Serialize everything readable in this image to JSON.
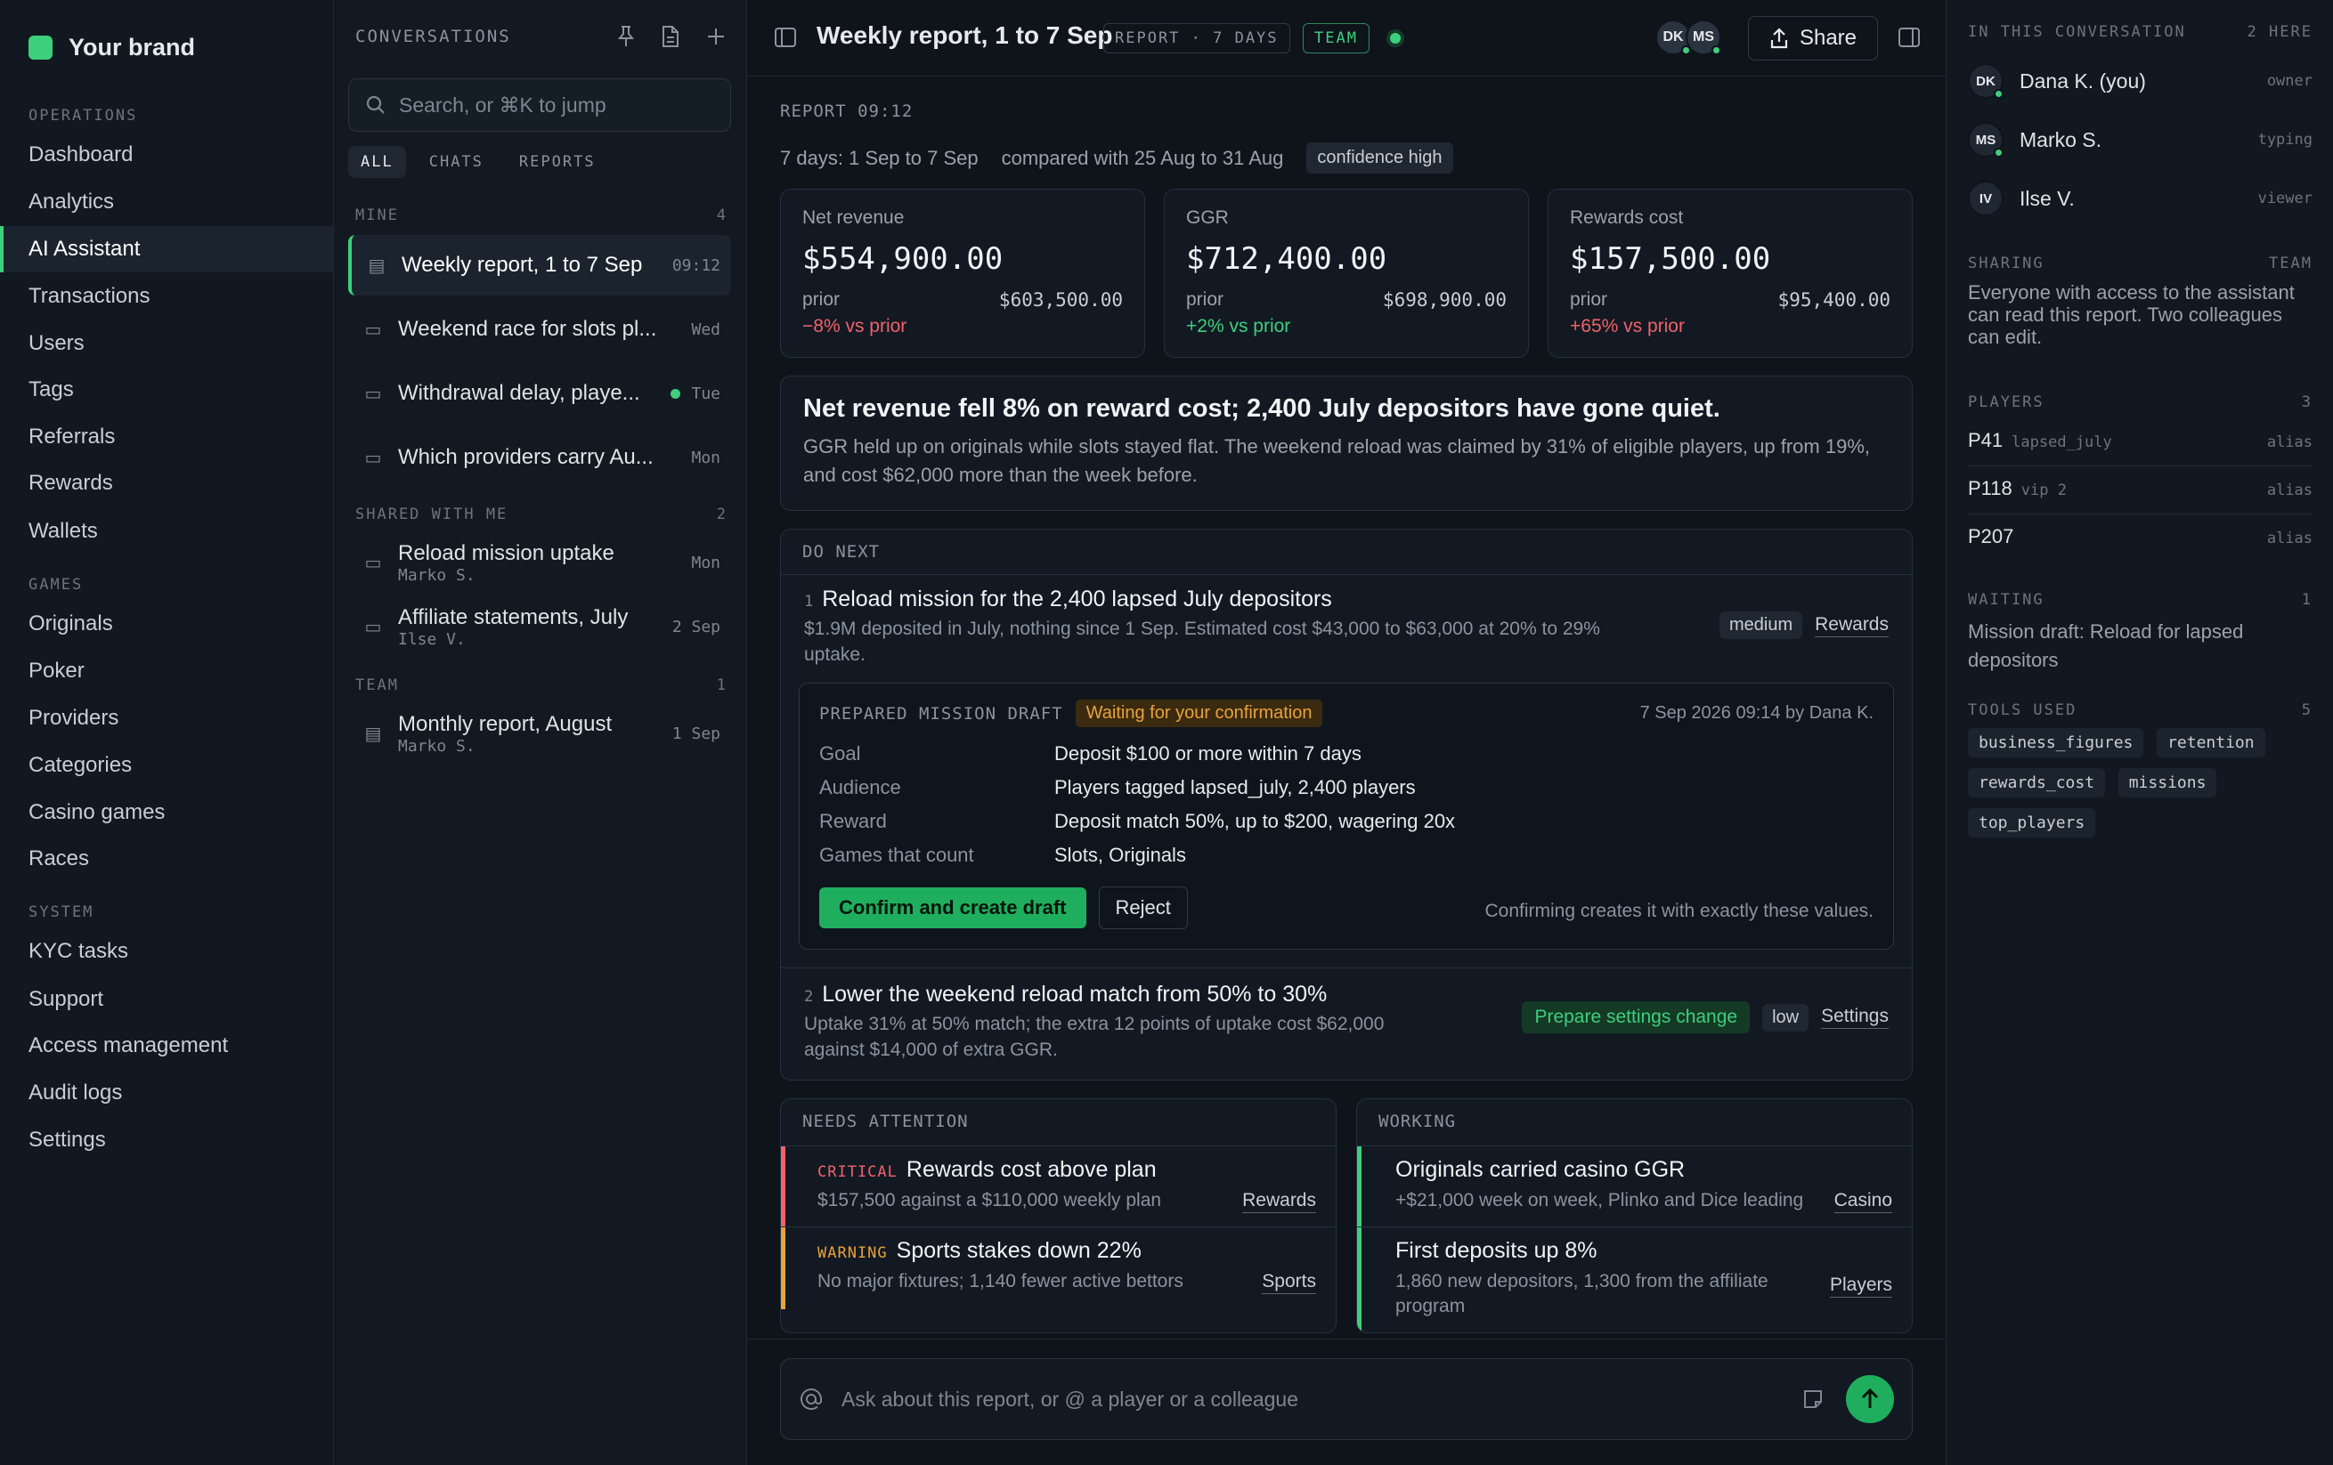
{
  "nav": {
    "brand": "Your brand",
    "sections": [
      {
        "label": "OPERATIONS",
        "items": [
          "Dashboard",
          "Analytics",
          "AI Assistant",
          "Transactions",
          "Users",
          "Tags",
          "Referrals",
          "Rewards",
          "Wallets"
        ]
      },
      {
        "label": "GAMES",
        "items": [
          "Originals",
          "Poker",
          "Providers",
          "Categories",
          "Casino games",
          "Races"
        ]
      },
      {
        "label": "SYSTEM",
        "items": [
          "KYC tasks",
          "Support",
          "Access management",
          "Audit logs",
          "Settings"
        ]
      }
    ],
    "active": "AI Assistant"
  },
  "conversations": {
    "title": "CONVERSATIONS",
    "search_placeholder": "Search, or ⌘K to jump",
    "filters": [
      "ALL",
      "CHATS",
      "REPORTS"
    ],
    "active_filter": "ALL",
    "groups": [
      {
        "label": "MINE",
        "count": "4",
        "items": [
          {
            "title": "Weekly report, 1 to 7 Sep",
            "time": "09:12",
            "icon": "document-icon",
            "active": true
          },
          {
            "title": "Weekend race for slots pl...",
            "time": "Wed",
            "icon": "chat-icon"
          },
          {
            "title": "Withdrawal delay, playe...",
            "time": "Tue",
            "icon": "chat-icon",
            "unread": true
          },
          {
            "title": "Which providers carry Au...",
            "time": "Mon",
            "icon": "chat-icon"
          }
        ]
      },
      {
        "label": "SHARED WITH ME",
        "count": "2",
        "items": [
          {
            "title": "Reload mission uptake",
            "sub": "Marko S.",
            "time": "Mon",
            "icon": "chat-icon"
          },
          {
            "title": "Affiliate statements, July",
            "sub": "Ilse V.",
            "time": "2 Sep",
            "icon": "chat-icon"
          }
        ]
      },
      {
        "label": "TEAM",
        "count": "1",
        "items": [
          {
            "title": "Monthly report, August",
            "sub": "Marko S.",
            "time": "1 Sep",
            "icon": "document-icon"
          }
        ]
      }
    ]
  },
  "header": {
    "title": "Weekly report, 1 to 7 Sep",
    "tag_report": "REPORT · 7 DAYS",
    "tag_team": "TEAM",
    "avatars": [
      "DK",
      "MS"
    ],
    "share": "Share"
  },
  "report": {
    "label": "REPORT 09:12",
    "period": "7 days: 1 Sep to 7 Sep",
    "compared": "compared with 25 Aug to 31 Aug",
    "confidence": "confidence high",
    "metrics": [
      {
        "label": "Net revenue",
        "value": "$554,900.00",
        "prior_label": "prior",
        "prior": "$603,500.00",
        "change": "−8% vs prior",
        "status": "negative"
      },
      {
        "label": "GGR",
        "value": "$712,400.00",
        "prior_label": "prior",
        "prior": "$698,900.00",
        "change": "+2% vs prior",
        "status": "positive"
      },
      {
        "label": "Rewards cost",
        "value": "$157,500.00",
        "prior_label": "prior",
        "prior": "$95,400.00",
        "change": "+65% vs prior",
        "status": "negative"
      }
    ],
    "headline": "Net revenue fell 8% on reward cost; 2,400 July depositors have gone quiet.",
    "summary": "GGR held up on originals while slots stayed flat. The weekend reload was claimed by 31% of eligible players, up from 19%, and cost $62,000 more than the week before."
  },
  "do_next": {
    "title": "DO NEXT",
    "actions": [
      {
        "num": "1",
        "title": "Reload mission for the 2,400 lapsed July depositors",
        "desc": "$1.9M deposited in July, nothing since 1 Sep. Estimated cost $43,000 to $63,000 at 20% to 29% uptake.",
        "impact": "medium",
        "link": "Rewards"
      },
      {
        "num": "2",
        "title": "Lower the weekend reload match from 50% to 30%",
        "desc": "Uptake 31% at 50% match; the extra 12 points of uptake cost $62,000 against $14,000 of extra GGR.",
        "prepare": "Prepare settings change",
        "impact": "low",
        "link": "Settings"
      }
    ],
    "draft": {
      "label": "PREPARED MISSION DRAFT",
      "status": "Waiting for your confirmation",
      "meta": "7 Sep 2026 09:14 by Dana K.",
      "rows": [
        {
          "k": "Goal",
          "v": "Deposit $100 or more within 7 days"
        },
        {
          "k": "Audience",
          "v": "Players tagged lapsed_july, 2,400 players"
        },
        {
          "k": "Reward",
          "v": "Deposit match 50%, up to $200, wagering 20x"
        },
        {
          "k": "Games that count",
          "v": "Slots, Originals"
        }
      ],
      "confirm": "Confirm and create draft",
      "reject": "Reject",
      "note": "Confirming creates it with exactly these values."
    }
  },
  "needs_attention": {
    "title": "NEEDS ATTENTION",
    "items": [
      {
        "level": "CRITICAL",
        "title": "Rewards cost above plan",
        "desc": "$157,500 against a $110,000 weekly plan",
        "link": "Rewards"
      },
      {
        "level": "WARNING",
        "title": "Sports stakes down 22%",
        "desc": "No major fixtures; 1,140 fewer active bettors",
        "link": "Sports"
      }
    ]
  },
  "working": {
    "title": "WORKING",
    "items": [
      {
        "title": "Originals carried casino GGR",
        "desc": "+$21,000 week on week, Plinko and Dice leading",
        "link": "Casino"
      },
      {
        "title": "First deposits up 8%",
        "desc": "1,860 new depositors, 1,300 from the affiliate program",
        "link": "Players"
      }
    ]
  },
  "composer": {
    "placeholder": "Ask about this report, or @ a player or a colleague"
  },
  "side": {
    "people_label": "IN THIS CONVERSATION",
    "people_count": "2 HERE",
    "people": [
      {
        "initials": "DK",
        "name": "Dana K. (you)",
        "role": "owner",
        "online": true
      },
      {
        "initials": "MS",
        "name": "Marko S.",
        "role": "typing",
        "online": true
      },
      {
        "initials": "IV",
        "name": "Ilse V.",
        "role": "viewer",
        "online": false
      }
    ],
    "sharing_label": "SHARING",
    "sharing_scope": "TEAM",
    "sharing_text": "Everyone with access to the assistant can read this report. Two colleagues can edit.",
    "players_label": "PLAYERS",
    "players_count": "3",
    "players": [
      {
        "id": "P41",
        "tag": "lapsed_july",
        "kind": "alias"
      },
      {
        "id": "P118",
        "tag": "vip 2",
        "kind": "alias"
      },
      {
        "id": "P207",
        "tag": "",
        "kind": "alias"
      }
    ],
    "waiting_label": "WAITING",
    "waiting_count": "1",
    "waiting_text": "Mission draft: Reload for lapsed depositors",
    "tools_label": "TOOLS USED",
    "tools_count": "5",
    "tools": [
      "business_figures",
      "retention",
      "rewards_cost",
      "missions",
      "top_players"
    ]
  },
  "colors": {
    "accent": "#3ecf7c",
    "negative": "#f2626a",
    "warning": "#e9a23b",
    "background": "#0f141b"
  }
}
